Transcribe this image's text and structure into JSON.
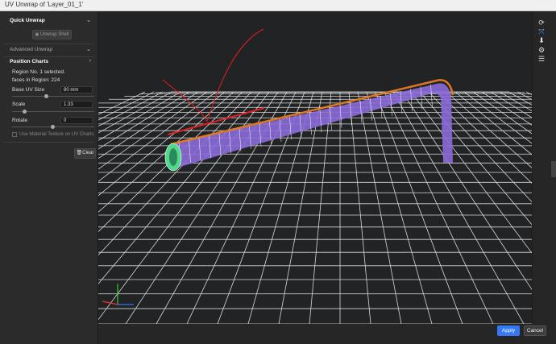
{
  "window": {
    "title": "UV Unwrap of 'Layer_01_1'"
  },
  "sidebar": {
    "quick_unwrap": {
      "title": "Quick Unwrap",
      "unwrap_shell_label": "Unwrap Shell"
    },
    "advanced_unwrap": {
      "title": "Advanced Unwrap"
    },
    "position_charts": {
      "title": "Position Charts",
      "region_selected": "Region No. 1 selected.",
      "faces_in_region": "faces in Region: 224",
      "base_uv_size": {
        "label": "Base UV Size",
        "value": "80 mm"
      },
      "scale": {
        "label": "Scale",
        "value": "1.33"
      },
      "rotate": {
        "label": "Rotate",
        "value": "0"
      },
      "use_material_texture": {
        "label": "Use Material Texture on UV Charts",
        "checked": false
      }
    },
    "clear_label": "Clear"
  },
  "footer": {
    "apply_label": "Apply",
    "cancel_label": "Cancel"
  },
  "toolstrip": {
    "icons": [
      "rotate-view-icon",
      "fit-view-icon",
      "move-down-icon",
      "settings-icon",
      "layers-icon"
    ]
  },
  "colors": {
    "accent": "#3478f6",
    "pipe_seam": "#e07820",
    "annotation": "#e02020"
  }
}
